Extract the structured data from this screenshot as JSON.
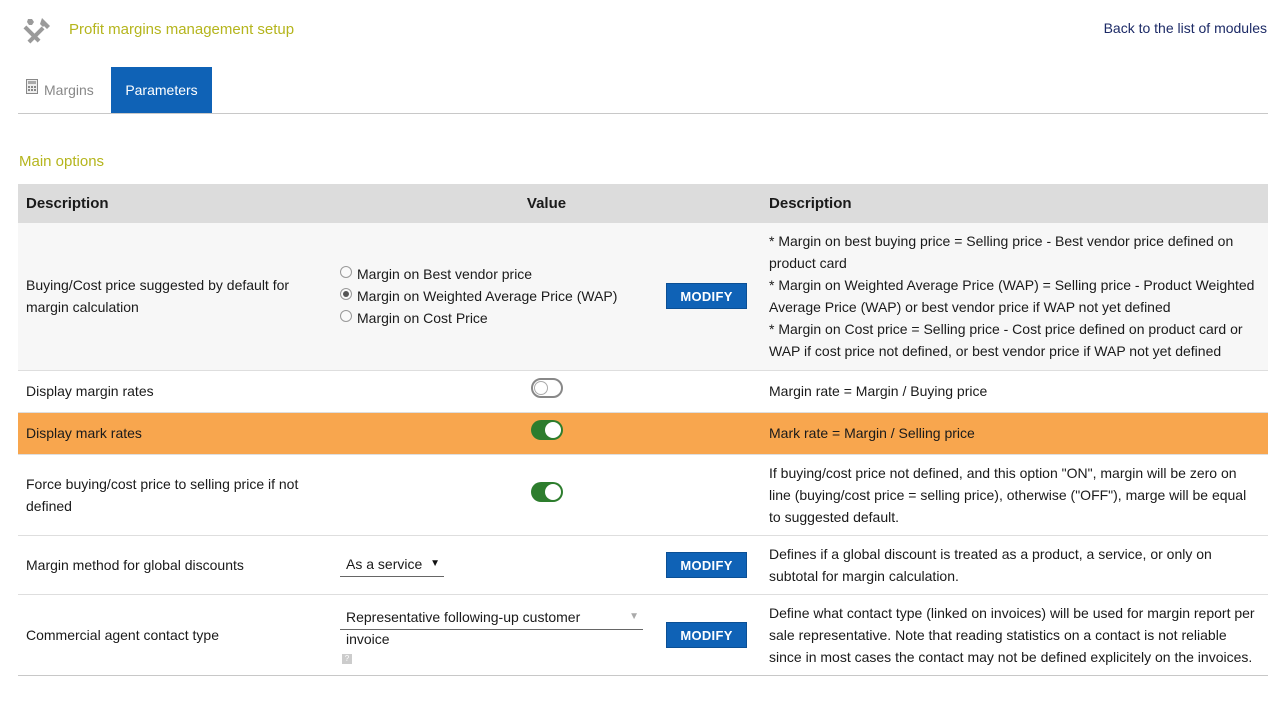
{
  "header": {
    "title": "Profit margins management setup",
    "back_link": "Back to the list of modules",
    "icon": "tools-icon"
  },
  "tabs": [
    {
      "label": "Margins",
      "active": false,
      "icon": "calculator-icon"
    },
    {
      "label": "Parameters",
      "active": true
    }
  ],
  "section_title": "Main options",
  "table": {
    "headers": {
      "description": "Description",
      "value": "Value",
      "help": "Description"
    },
    "modify_label": "MODIFY",
    "rows": [
      {
        "label": "Buying/Cost price suggested by default for margin calculation",
        "radios": [
          {
            "label": "Margin on Best vendor price",
            "checked": false
          },
          {
            "label": "Margin on Weighted Average Price (WAP)",
            "checked": true
          },
          {
            "label": "Margin on Cost Price",
            "checked": false
          }
        ],
        "help": [
          "* Margin on best buying price = Selling price - Best vendor price defined on product card",
          "* Margin on Weighted Average Price (WAP) = Selling price - Product Weighted Average Price (WAP) or best vendor price if WAP not yet defined",
          "* Margin on Cost price = Selling price - Cost price defined on product card or WAP if cost price not defined, or best vendor price if WAP not yet defined"
        ]
      },
      {
        "label": "Display margin rates",
        "toggle": "off",
        "help": "Margin rate = Margin / Buying price"
      },
      {
        "label": "Display mark rates",
        "toggle": "on",
        "highlight": "#f8a64e",
        "help": "Mark rate = Margin / Selling price"
      },
      {
        "label": "Force buying/cost price to selling price if not defined",
        "toggle": "on",
        "help": "If buying/cost price not defined, and this option \"ON\", margin will be zero on line (buying/cost price = selling price), otherwise (\"OFF\"), marge will be equal to suggested default."
      },
      {
        "label": "Margin method for global discounts",
        "select_value": "As a service",
        "help": "Defines if a global discount is treated as a product, a service, or only on subtotal for margin calculation."
      },
      {
        "label": "Commercial agent contact type",
        "select_value": "Representative following-up customer invoice",
        "help_icon": "?",
        "help": "Define what contact type (linked on invoices) will be used for margin report per sale representative. Note that reading statistics on a contact is not reliable since in most cases the contact may not be defined explicitely on the invoices."
      }
    ]
  },
  "colors": {
    "accent": "#0f62b6",
    "title": "#b5b51d",
    "highlight_row": "#f8a64e",
    "toggle_on": "#2d7d2d"
  }
}
